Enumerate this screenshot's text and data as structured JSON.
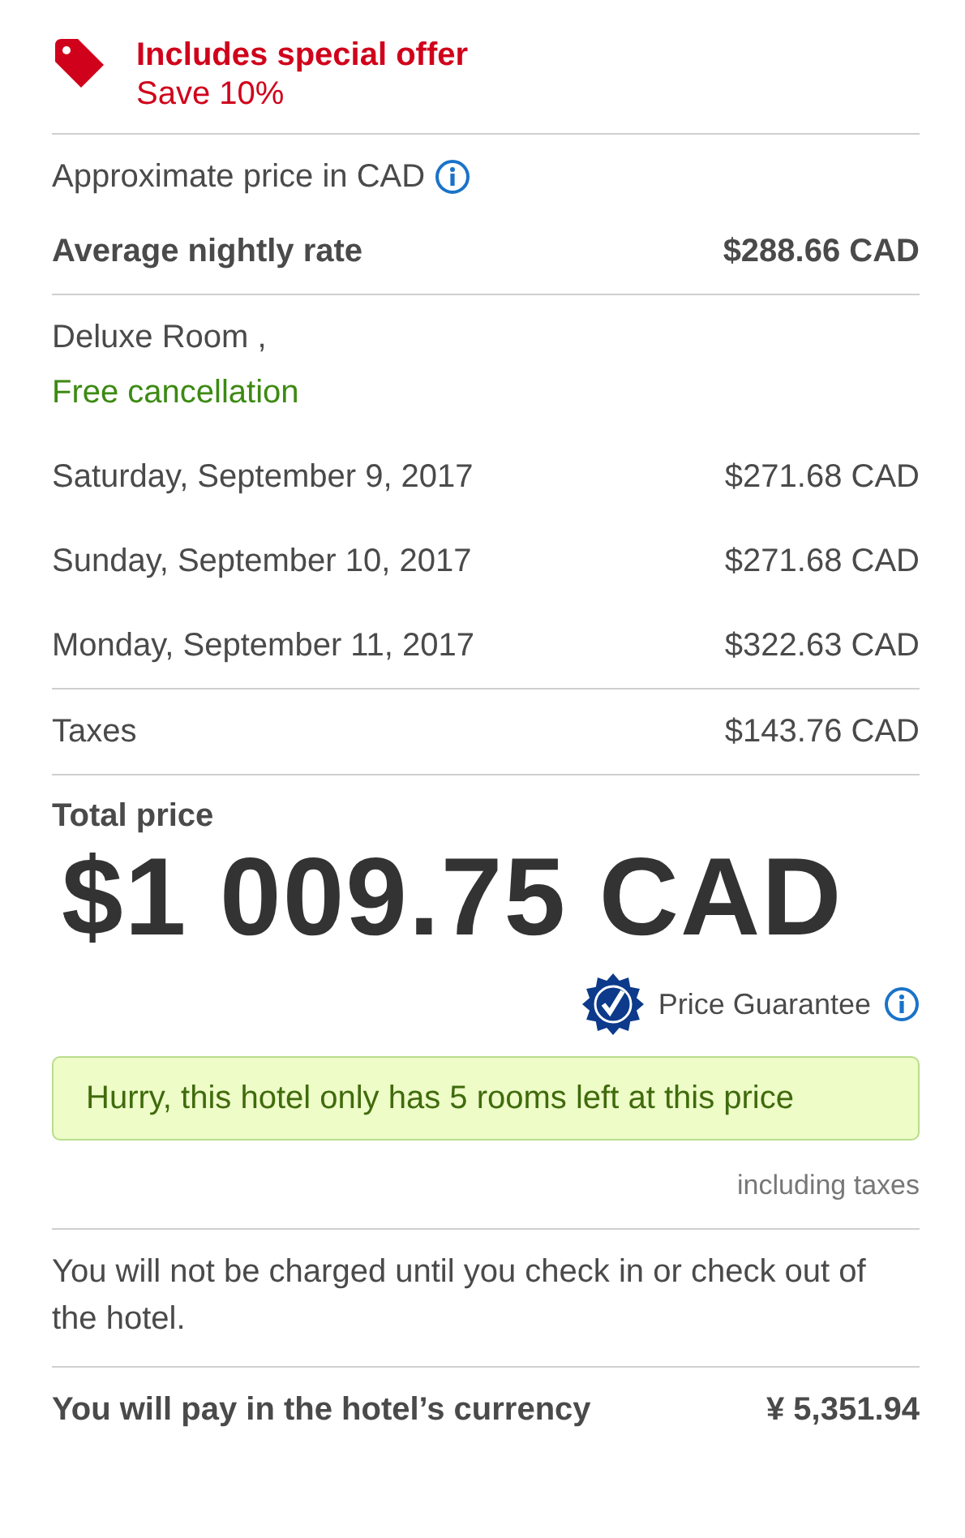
{
  "offer": {
    "title": "Includes special offer",
    "subtitle": "Save 10%"
  },
  "approx": {
    "label": "Approximate price in CAD"
  },
  "average": {
    "label": "Average nightly rate",
    "value": "$288.66 CAD"
  },
  "room": {
    "name": "Deluxe Room ,",
    "cancellation": "Free cancellation"
  },
  "nights": [
    {
      "date": "Saturday, September 9, 2017",
      "price": "$271.68 CAD"
    },
    {
      "date": "Sunday, September 10, 2017",
      "price": "$271.68 CAD"
    },
    {
      "date": "Monday, September 11, 2017",
      "price": "$322.63 CAD"
    }
  ],
  "taxes": {
    "label": "Taxes",
    "value": "$143.76 CAD"
  },
  "total": {
    "label": "Total price",
    "value": "$1 009.75 CAD",
    "guarantee": "Price Guarantee"
  },
  "alert": "Hurry, this hotel only has 5 rooms left at this price",
  "tax_note": "including taxes",
  "charge_note": "You will not be charged until you check in or check out of the hotel.",
  "hotel_currency": {
    "label": "You will pay in the hotel’s currency",
    "value": "¥ 5,351.94"
  }
}
